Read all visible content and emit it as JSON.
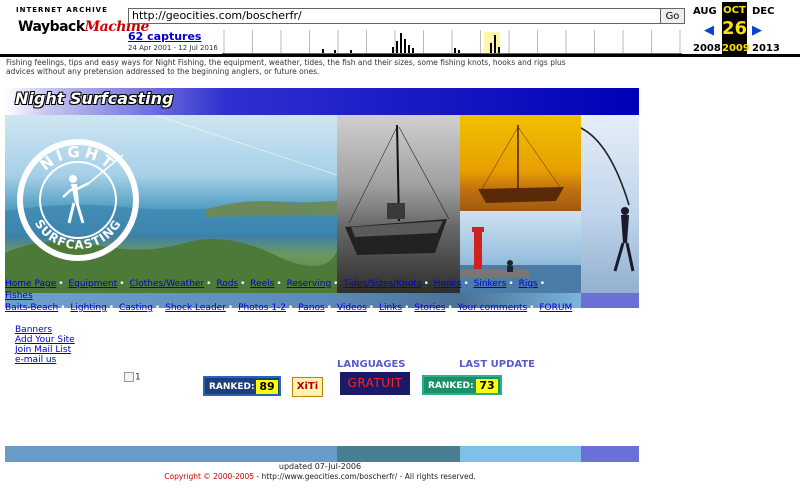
{
  "wayback": {
    "logo_top": "INTERNET ARCHIVE",
    "logo_main_a": "Wayback",
    "logo_main_b": "Machine",
    "url": "http://geocities.com/boscherfr/",
    "go_label": "Go",
    "captures": "62 captures",
    "date_range": "24 Apr 2001 - 12 Jul 2016",
    "prev_month": "AUG",
    "cur_month": "OCT",
    "next_month": "DEC",
    "cur_day": "26",
    "prev_year": "2008",
    "cur_year": "2009",
    "next_year": "2013",
    "prev_arrow": "◀",
    "next_arrow": "▶"
  },
  "intro": "Fishing feelings, tips and easy ways for Night Fishing, the equipment, weather, tides, the fish and their sizes, some fishing knots, hooks and rigs plus advices without any pretension addressed to the beginning anglers, or future ones.",
  "title": "Night Surfcasting",
  "seal": {
    "top": "NIGHT",
    "bottom": "SURFCASTING"
  },
  "nav": [
    "Home Page",
    "Equipment",
    "Clothes/Weather",
    "Rods",
    "Reels",
    "Reserving",
    "Tides/Sizes/Knots",
    "Hooks",
    "Sinkers",
    "Rigs",
    "Fishes",
    "Baits-Beach",
    "Lighting",
    "Casting",
    "Shock Leader",
    "Photos 1-2",
    "Panos",
    "Videos",
    "Links",
    "Stories",
    "Your comments",
    "FORUM"
  ],
  "nav_sep": "•",
  "side_links": [
    "Banners",
    "Add Your Site",
    "Join Mail List",
    "e-mail us"
  ],
  "broken_img_alt": "1",
  "ranked1": {
    "label": "RANKED:",
    "value": "89"
  },
  "xiti": "XiTi",
  "gratuit": "GRATUIT",
  "ranked2": {
    "label": "RANKED:",
    "value": "73"
  },
  "languages": "LANGUAGES",
  "last_update": "LAST UPDATE",
  "updated": "updated 07-Jul-2006",
  "copyright_red": "Copyright © 2000-2005",
  "copyright_rest": " - http://www.geocities.com/boscherfr/ - All rights reserved."
}
